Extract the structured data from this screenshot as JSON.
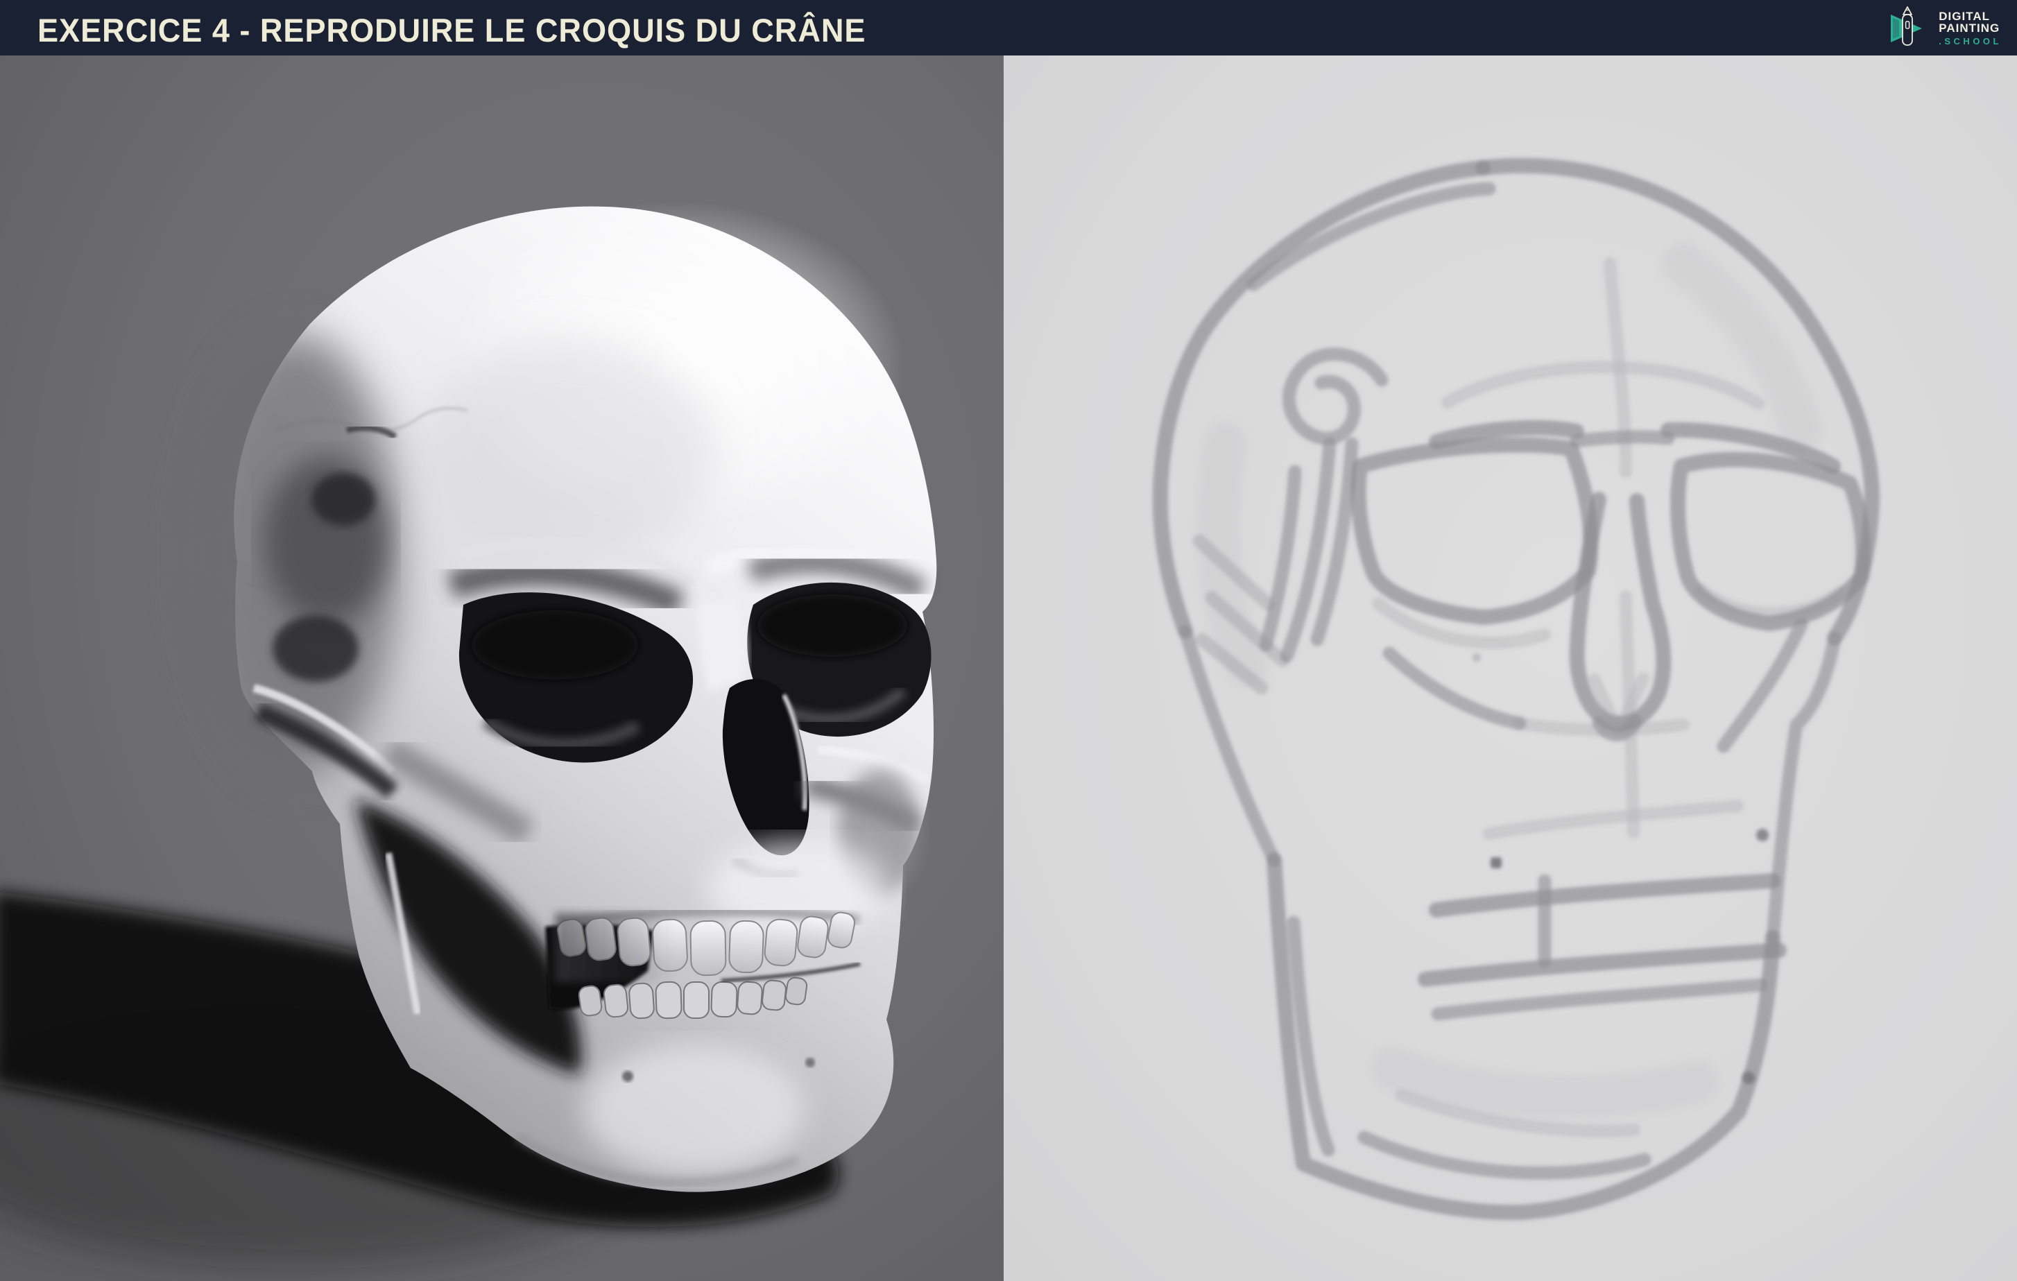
{
  "header": {
    "title": "EXERCICE 4 - REPRODUIRE LE CROQUIS DU CRÂNE",
    "logo": {
      "line1": "DIGITAL",
      "line2": "PAINTING",
      "line3": ".SCHOOL"
    }
  },
  "panels": {
    "left": {
      "alt": "3D render of a human skull in three-quarter view, lit from the upper right, casting a dark shadow to the lower left on a grey background"
    },
    "right": {
      "alt": "Loose grey construction sketch of the same skull on a light grey background"
    }
  },
  "icons": {
    "logo": "stylus-in-play-triangle"
  },
  "colors": {
    "header_bg": "#1a2132",
    "title_text": "#eeebd7",
    "logo_teal": "#2fae93",
    "logo_white": "#f2efe2",
    "render_bg": "#6f6f71",
    "render_bg_edge": "#5d5d5f",
    "cast_shadow": "#0c0c0c",
    "bone_light": "#fbfbfd",
    "bone_dark": "#98989c",
    "sketch_bg": "#d8d8d9",
    "sketch_stroke": "#919195"
  }
}
